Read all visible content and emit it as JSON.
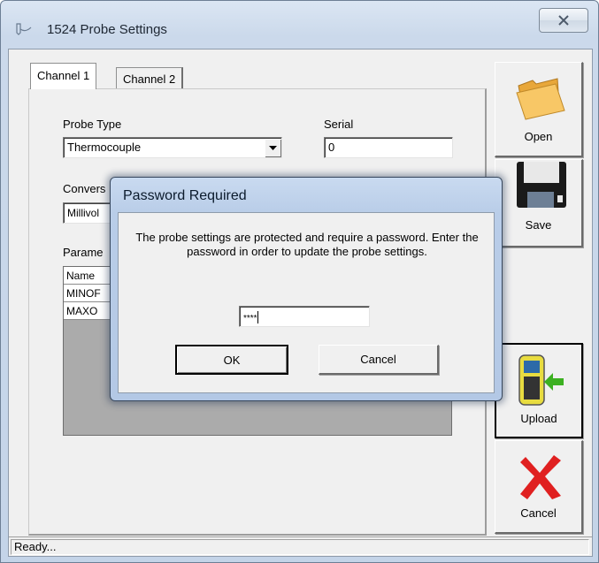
{
  "window": {
    "title": "1524 Probe Settings",
    "status": "Ready..."
  },
  "tabs": [
    {
      "label": "Channel 1",
      "active": true
    },
    {
      "label": "Channel 2",
      "active": false
    }
  ],
  "form": {
    "probe_type_label": "Probe Type",
    "probe_type_value": "Thermocouple",
    "serial_label": "Serial",
    "serial_value": "0",
    "conversion_label": "Convers",
    "conversion_value": "Millivol",
    "parameters_label": "Parame",
    "grid_rows": [
      "Name",
      "MINOF",
      "MAXO"
    ]
  },
  "side_buttons": {
    "open": "Open",
    "save": "Save",
    "upload": "Upload",
    "cancel": "Cancel"
  },
  "dialog": {
    "title": "Password Required",
    "message": "The probe settings are protected and require a password. Enter the password in order to update the probe settings.",
    "password_mask": "****",
    "ok": "OK",
    "cancel": "Cancel"
  },
  "colors": {
    "folder": "#f5b94e",
    "cancel_x": "#e02020",
    "upload_arrow": "#3cb021"
  }
}
